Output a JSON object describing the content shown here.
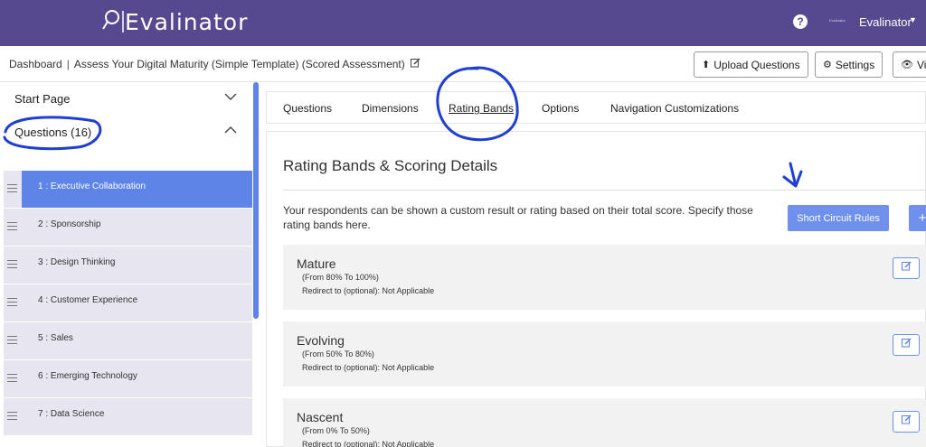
{
  "app": {
    "logo_text": "Evalinator",
    "user_small": "Evalinator",
    "user_name": "Evalinator"
  },
  "breadcrumb": {
    "root": "Dashboard",
    "separator": "|",
    "current": "Assess Your Digital Maturity (Simple Template) (Scored Assessment)"
  },
  "toolbar": {
    "upload_label": "Upload Questions",
    "settings_label": "Settings",
    "view_label": "Vi"
  },
  "sidebar": {
    "start_page": "Start Page",
    "questions_header": "Questions (16)",
    "items": [
      {
        "label": "1 : Executive Collaboration",
        "active": true
      },
      {
        "label": "2 : Sponsorship"
      },
      {
        "label": "3 : Design Thinking"
      },
      {
        "label": "4 : Customer Experience"
      },
      {
        "label": "5 : Sales"
      },
      {
        "label": "6 : Emerging Technology"
      },
      {
        "label": "7 : Data Science"
      }
    ]
  },
  "tabs": [
    "Questions",
    "Dimensions",
    "Rating Bands",
    "Options",
    "Navigation Customizations"
  ],
  "active_tab": "Rating Bands",
  "content": {
    "title": "Rating Bands & Scoring Details",
    "description": "Your respondents can be shown a custom result or rating based on their total score. Specify those rating bands here.",
    "short_circuit_label": "Short Circuit Rules",
    "add_label": "+",
    "bands": [
      {
        "name": "Mature",
        "range": "(From 80% To 100%)",
        "redirect": "Redirect to (optional): Not Applicable"
      },
      {
        "name": "Evolving",
        "range": "(From 50% To 80%)",
        "redirect": "Redirect to (optional): Not Applicable"
      },
      {
        "name": "Nascent",
        "range": "(From 0% To 50%)",
        "redirect": "Redirect to (optional): Not Applicable"
      }
    ]
  },
  "colors": {
    "header_bg": "#57498f",
    "accent": "#5e84e8",
    "annotation": "#1f3fd1"
  }
}
